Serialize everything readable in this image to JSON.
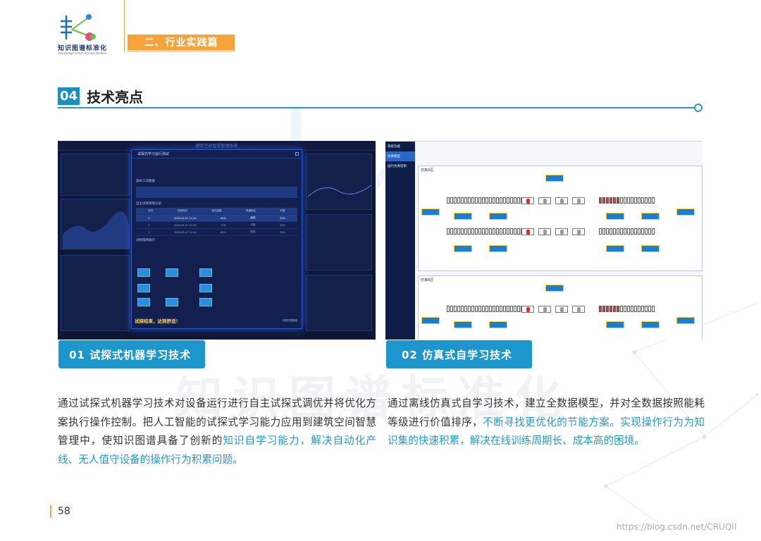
{
  "header": {
    "logo_text": "知识图谱标准化",
    "logo_subtitle": "Knowledge Graph Standardization",
    "section_tag": "二、行业实践篇"
  },
  "heading": {
    "number": "04",
    "title": "技术亮点"
  },
  "watermark": "知识图谱标准化",
  "screenshot1": {
    "app_title": "建筑空间智慧管理系统",
    "modal_title": "试探式学习运行测试",
    "basic_section": "基本工况数据",
    "record_section": "自主试探策略记录",
    "path_section": "试探策略展示",
    "end_message": "试探结束，达到舒适！",
    "end_button": "查看完整策略",
    "columns": [
      "序号",
      "开始时间",
      "室内温度",
      "风速档位",
      "开度"
    ],
    "rows": [
      [
        "1",
        "2020-02-07 11:30",
        "60%",
        "高档",
        "25%"
      ],
      [
        "2",
        "2020-02-07 11:35",
        "70%",
        "中档",
        "25%"
      ],
      [
        "3",
        "2020-02-07 11:40",
        "60%",
        "低档",
        "30%"
      ]
    ]
  },
  "screenshot2": {
    "sidebar_items": [
      "系统功能",
      "仿真模型",
      "运行仿真结果"
    ],
    "section_a": "仿真A区",
    "section_b": "仿真B区"
  },
  "captions": {
    "left": "01 试探式机器学习技术",
    "right": "02 仿真式自学习技术"
  },
  "paragraphs": {
    "left_plain": "通过试探式机器学习技术对设备运行进行自主试探式调优并将优化方案执行操作控制。把人工智能的试探式学习能力应用到建筑空间智慧管理中，使知识图谱具备了创新的",
    "left_highlight": "知识自学习能力，解决自动化产线、无人值守设备的操作行为积累问题。",
    "right_plain": "通过离线仿真式自学习技术，建立全数据模型，并对全数据按照能耗等级进行价值排序，",
    "right_highlight": "不断寻找更优化的节能方案。实现操作行为为知识集的快速积累，解决在线训练周期长、成本高的困境。"
  },
  "footer": {
    "page_number": "58",
    "credit": "https://blog.csdn.net/CRUQII"
  },
  "colors": {
    "accent_orange": "#f7a33a",
    "accent_blue": "#1c96cc",
    "highlight_text": "#1f9ad0"
  }
}
